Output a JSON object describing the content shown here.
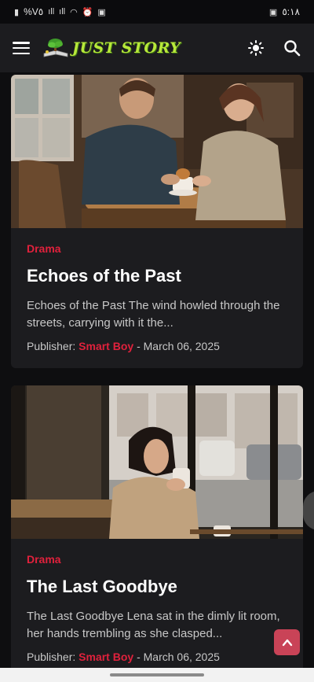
{
  "status_bar": {
    "left_text": "%V٥",
    "right_time": "٥:١٨"
  },
  "app": {
    "logo_text": "JUST STORY"
  },
  "stories": [
    {
      "category": "Drama",
      "title": "Echoes of the Past",
      "excerpt": "Echoes of the Past The wind howled through the streets, carrying with it the...",
      "publisher_label": "Publisher:",
      "publisher_name": "Smart Boy",
      "date": "- March 06, 2025"
    },
    {
      "category": "Drama",
      "title": "The Last Goodbye",
      "excerpt": "The Last Goodbye Lena sat in the dimly lit room, her hands trembling as she clasped...",
      "publisher_label": "Publisher:",
      "publisher_name": "Smart Boy",
      "date": "- March 06, 2025"
    }
  ],
  "colors": {
    "accent": "#e0213c",
    "logo_green": "#b7e83a",
    "card_bg": "#1c1c1f",
    "page_bg": "#0e0e10"
  }
}
